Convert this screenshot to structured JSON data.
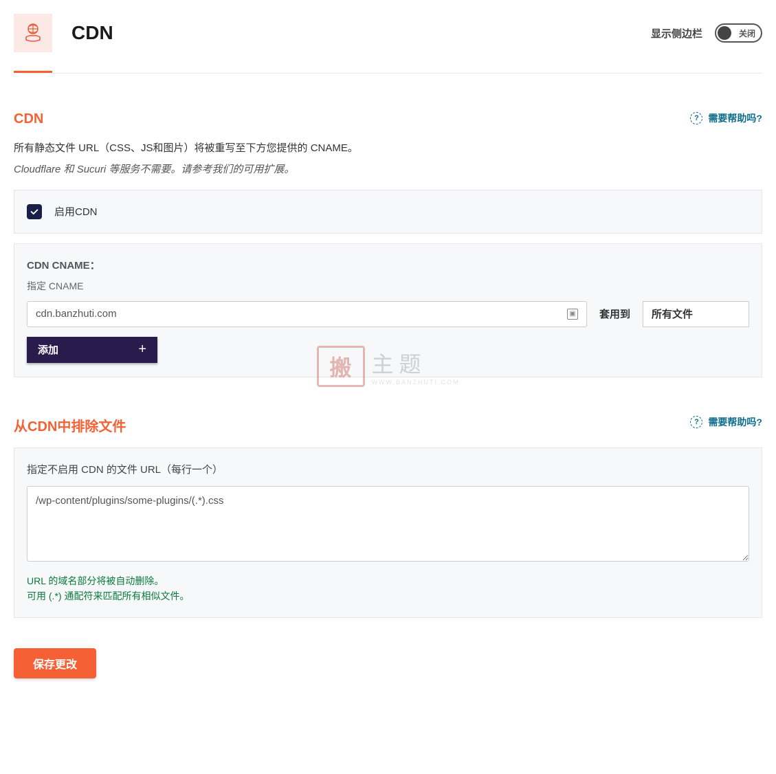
{
  "header": {
    "title": "CDN",
    "sidebar_label": "显示侧边栏",
    "toggle_text": "关闭"
  },
  "cdn_section": {
    "title": "CDN",
    "help_text": "需要帮助吗?",
    "desc": "所有静态文件 URL（CSS、JS和图片）将被重写至下方您提供的 CNAME。",
    "desc_italic": "Cloudflare 和 Sucuri 等服务不需要。请参考我们的可用扩展。",
    "enable_label": "启用CDN",
    "cname_label": "CDN CNAME：",
    "cname_sublabel": "指定 CNAME",
    "cname_value": "cdn.banzhuti.com",
    "apply_to_label": "套用到",
    "apply_to_value": "所有文件",
    "add_button": "添加"
  },
  "exclude_section": {
    "title": "从CDN中排除文件",
    "help_text": "需要帮助吗?",
    "textarea_label": "指定不启用 CDN 的文件 URL（每行一个）",
    "textarea_value": "/wp-content/plugins/some-plugins/(.*).css",
    "hint1": "URL 的域名部分将被自动删除。",
    "hint2": "可用 (.*) 通配符来匹配所有相似文件。"
  },
  "save_button": "保存更改",
  "watermark": {
    "stamp": "搬",
    "main": "主题",
    "sub": "WWW.BANZHUTI.COM"
  }
}
